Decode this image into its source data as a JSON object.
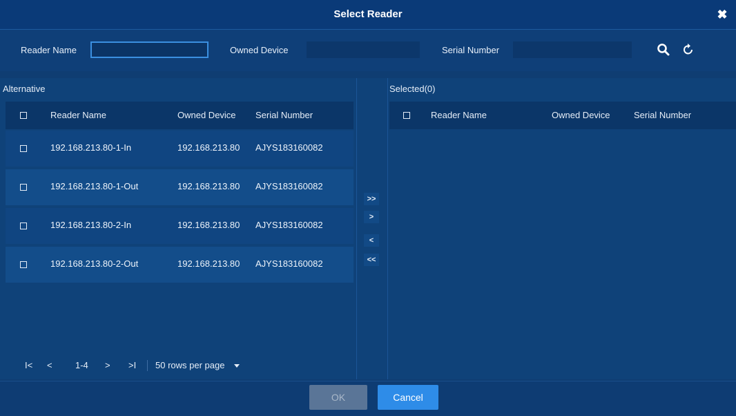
{
  "dialog": {
    "title": "Select Reader"
  },
  "search": {
    "reader_name_label": "Reader Name",
    "reader_name_value": "",
    "owned_device_label": "Owned Device",
    "owned_device_value": "",
    "serial_number_label": "Serial Number",
    "serial_number_value": ""
  },
  "alternative": {
    "title": "Alternative",
    "columns": [
      "Reader Name",
      "Owned Device",
      "Serial Number"
    ],
    "rows": [
      {
        "reader_name": "192.168.213.80-1-In",
        "owned_device": "192.168.213.80",
        "serial_number": "AJYS183160082"
      },
      {
        "reader_name": "192.168.213.80-1-Out",
        "owned_device": "192.168.213.80",
        "serial_number": "AJYS183160082"
      },
      {
        "reader_name": "192.168.213.80-2-In",
        "owned_device": "192.168.213.80",
        "serial_number": "AJYS183160082"
      },
      {
        "reader_name": "192.168.213.80-2-Out",
        "owned_device": "192.168.213.80",
        "serial_number": "AJYS183160082"
      }
    ]
  },
  "selected": {
    "title": "Selected(0)",
    "columns": [
      "Reader Name",
      "Owned Device",
      "Serial Number"
    ]
  },
  "transfer": {
    "add_all": ">>",
    "add": ">",
    "remove": "<",
    "remove_all": "<<"
  },
  "pager": {
    "first": "I<",
    "prev": "<",
    "range": "1-4",
    "next": ">",
    "last": ">I",
    "rows_per_page": "50 rows per page"
  },
  "footer": {
    "ok": "OK",
    "cancel": "Cancel"
  },
  "icons": {
    "search": "search-icon",
    "refresh": "refresh-icon",
    "close": "close-icon",
    "dropdown": "caret-down-icon"
  },
  "colors": {
    "accent": "#2e8ce8",
    "background": "#0f3d72",
    "disabled": "#5a7597"
  }
}
